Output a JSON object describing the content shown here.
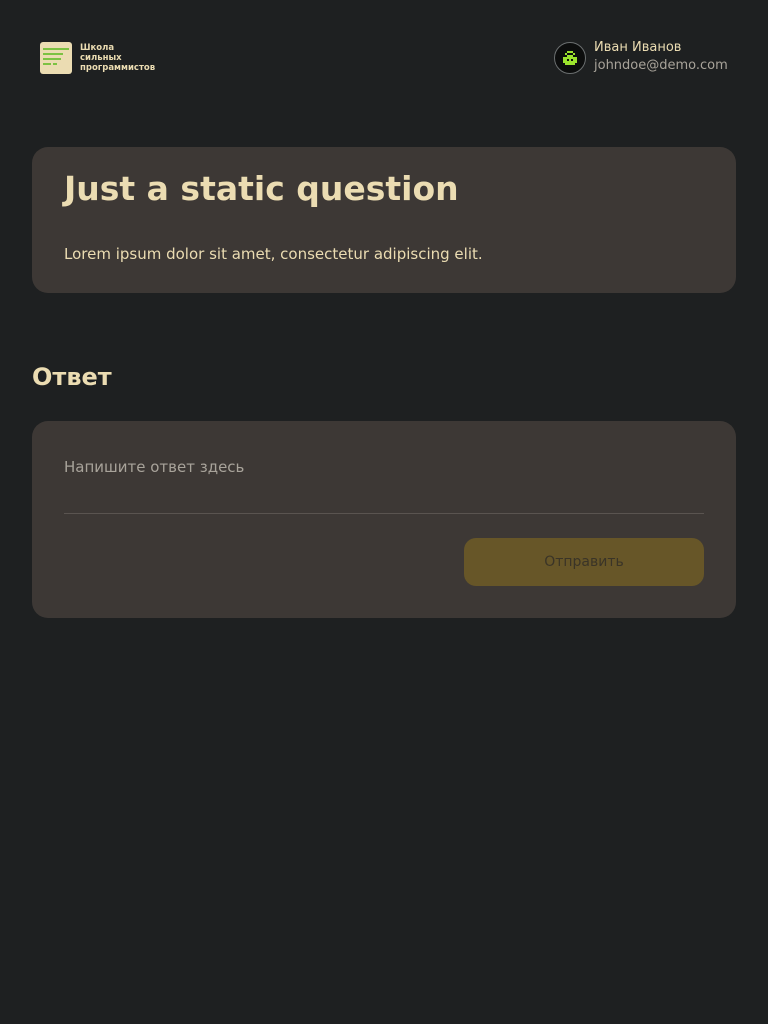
{
  "header": {
    "logo": {
      "icon": "school-logo-icon",
      "text": "Школа\nсильных\nпрограммистов"
    },
    "user": {
      "avatar_icon": "pixel-avatar-icon",
      "name": "Иван Иванов",
      "email": "johndoe@demo.com"
    }
  },
  "question": {
    "title": "Just a static question",
    "description": "Lorem ipsum dolor sit amet, consectetur adipiscing elit."
  },
  "answer": {
    "heading": "Ответ",
    "input_value": "",
    "input_placeholder": "Напишите ответ здесь",
    "submit_label": "Отправить"
  },
  "colors": {
    "background": "#1e2021",
    "card": "#3d3835",
    "text_primary": "#ebdcb2",
    "text_muted": "#a8a39a",
    "button_disabled": "#675628",
    "logo_accent": "#7cc242",
    "avatar_accent": "#9be22d"
  }
}
